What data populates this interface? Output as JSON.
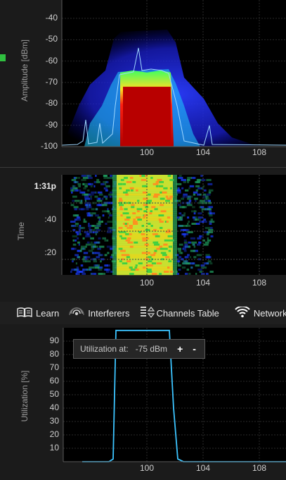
{
  "spectrum": {
    "axis_title": "Amplitude [dBm]",
    "y_ticks": [
      "-40",
      "-50",
      "-60",
      "-70",
      "-80",
      "-90",
      "-100"
    ],
    "x_ticks": [
      "100",
      "104",
      "108"
    ]
  },
  "waterfall": {
    "axis_title": "Time",
    "time_ticks": [
      "1:31p",
      ":40",
      ":20"
    ],
    "x_ticks": [
      "100",
      "104",
      "108"
    ]
  },
  "toolbar": {
    "learn": "Learn",
    "interferers": "Interferers",
    "channels_table": "Channels Table",
    "networks": "Networks"
  },
  "utilization": {
    "axis_title": "Utilization [%]",
    "y_ticks": [
      "90",
      "80",
      "70",
      "60",
      "50",
      "40",
      "30",
      "20",
      "10"
    ],
    "x_ticks": [
      "100",
      "104",
      "108"
    ],
    "label": "Utilization at:",
    "value": "-75 dBm",
    "plus": "+",
    "minus": "-"
  },
  "chart_data": [
    {
      "type": "area",
      "ylabel": "Amplitude [dBm]",
      "ylim": [
        -100,
        -35
      ],
      "x_ticks": [
        100,
        104,
        108
      ],
      "x": [
        96,
        97,
        97.9,
        98.1,
        99,
        100,
        101,
        101.7,
        101.9,
        103,
        105,
        108
      ],
      "series": [
        {
          "values": [
            -100,
            -100,
            -100,
            -67,
            -66,
            -67,
            -66,
            -67,
            -100,
            -100,
            -100,
            -100
          ]
        }
      ]
    },
    {
      "type": "heatmap",
      "ylabel": "Time",
      "x_ticks": [
        100,
        104,
        108
      ],
      "time_ticks": [
        "1:31p",
        ":40",
        ":20"
      ]
    },
    {
      "type": "line",
      "ylabel": "Utilization [%]",
      "ylim": [
        0,
        100
      ],
      "x_ticks": [
        100,
        104,
        108
      ],
      "x": [
        95.4,
        97.3,
        97.6,
        97.8,
        99,
        100,
        101,
        101.6,
        101.9,
        102.2,
        102.6,
        110
      ],
      "series": [
        {
          "values": [
            0,
            0,
            2,
            98,
            98,
            98,
            98,
            98,
            40,
            2,
            0,
            0
          ]
        }
      ]
    }
  ]
}
